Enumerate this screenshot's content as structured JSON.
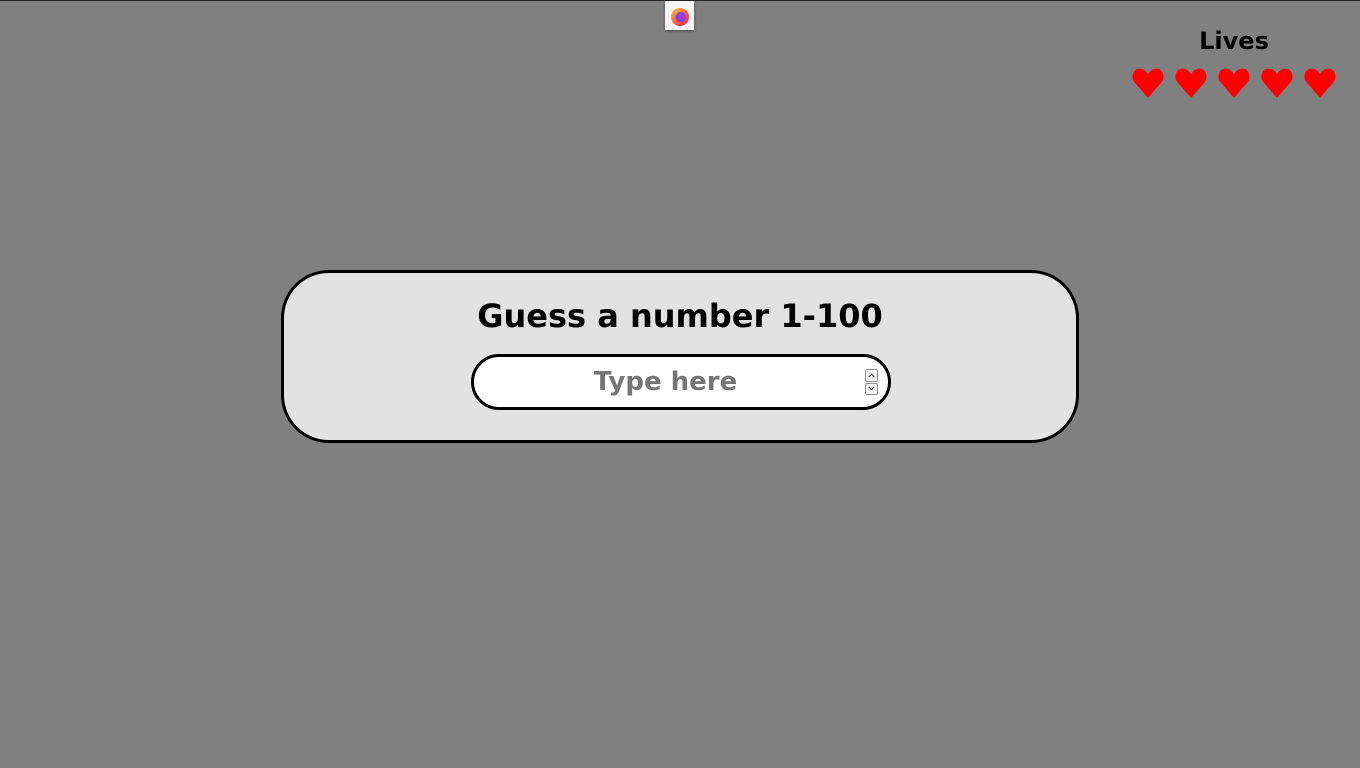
{
  "browser": {
    "icon": "firefox-icon"
  },
  "lives": {
    "title": "Lives",
    "count": 5,
    "max": 5,
    "heart_color": "#ff0000"
  },
  "game": {
    "prompt": "Guess a number 1-100",
    "input": {
      "value": "",
      "placeholder": "Type here",
      "min": 1,
      "max": 100
    }
  },
  "colors": {
    "background": "#808080",
    "card": "#e2e2e2",
    "border": "#000000"
  }
}
